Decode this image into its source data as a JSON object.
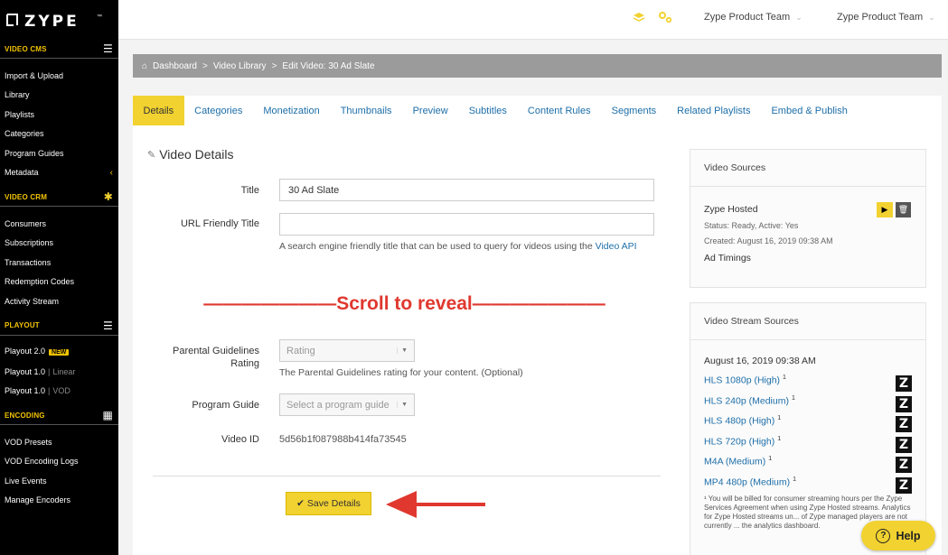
{
  "brand": {
    "logo_text": "ZYPE",
    "trademark": "™",
    "accent": "#f2d230",
    "link_color": "#1d6ea8"
  },
  "sidebar": {
    "sections": [
      {
        "title": "VIDEO CMS",
        "icon": "hamburger-icon",
        "items": [
          "Import & Upload",
          "Library",
          "Playlists",
          "Categories",
          "Program Guides",
          "Metadata"
        ]
      },
      {
        "title": "VIDEO CRM",
        "icon": "asterisk-icon",
        "items": [
          "Consumers",
          "Subscriptions",
          "Transactions",
          "Redemption Codes",
          "Activity Stream"
        ]
      },
      {
        "title": "PLAYOUT",
        "icon": "playout-icon",
        "items": [
          "Playout 2.0",
          "Playout 1.0",
          "Playout 1.0"
        ],
        "suffixes": [
          "",
          "Linear",
          "VOD"
        ],
        "badge": "NEW"
      },
      {
        "title": "ENCODING",
        "icon": "grid-icon",
        "items": [
          "VOD Presets",
          "VOD Encoding Logs",
          "Live Events",
          "Manage Encoders"
        ]
      }
    ],
    "separator": "|"
  },
  "topbar": {
    "team1": "Zype Product Team",
    "team2": "Zype Product Team"
  },
  "breadcrumb": {
    "home": "Dashboard",
    "items": [
      "Video Library",
      "Edit Video: 30 Ad Slate"
    ],
    "sep": ">"
  },
  "tabs": [
    "Details",
    "Categories",
    "Monetization",
    "Thumbnails",
    "Preview",
    "Subtitles",
    "Content Rules",
    "Segments",
    "Related Playlists",
    "Embed & Publish"
  ],
  "form": {
    "section_title": "Video Details",
    "title_label": "Title",
    "title_value": "30 Ad Slate",
    "url_label": "URL Friendly Title",
    "url_value": "",
    "url_help": "A search engine friendly title that can be used to query for videos using the",
    "url_help_link": "Video API",
    "scroll_note": "———————Scroll to reveal———————",
    "parental_label_1": "Parental Guidelines",
    "parental_label_2": "Rating",
    "parental_placeholder": "Rating",
    "parental_help": "The Parental Guidelines rating for your content. (Optional)",
    "program_label": "Program Guide",
    "program_placeholder": "Select a program guide",
    "video_id_label": "Video ID",
    "video_id_value": "5d56b1f087988b414fa73545",
    "save_label": "Save Details",
    "save_check": "✔"
  },
  "sources": {
    "title": "Video Sources",
    "name": "Zype Hosted",
    "status": "Status: Ready, Active: Yes",
    "created": "Created: August 16, 2019 09:38 AM",
    "ad_timings": "Ad Timings"
  },
  "streams": {
    "title": "Video Stream Sources",
    "date": "August 16, 2019 09:38 AM",
    "items": [
      "HLS 1080p (High)",
      "HLS 240p (Medium)",
      "HLS 480p (High)",
      "HLS 720p (High)",
      "M4A (Medium)",
      "MP4 480p (Medium)"
    ],
    "footnote_mark": "1",
    "footnote": "¹ You will be billed for consumer streaming hours per the Zype Services Agreement when using Zype Hosted streams. Analytics for Zype Hosted streams un... of Zype managed players are not currently ... the analytics dashboard."
  },
  "help_btn": {
    "label": "Help",
    "glyph": "?"
  }
}
